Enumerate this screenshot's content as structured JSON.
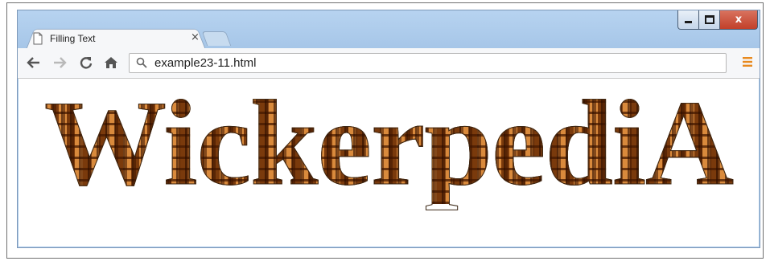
{
  "browser": {
    "tab_title": "Filling Text",
    "tab_close_glyph": "×",
    "close_glyph": "x",
    "url": "example23-11.html"
  },
  "page": {
    "text": "WickerpediA"
  },
  "icons": {
    "back": "back-arrow-icon",
    "forward": "forward-arrow-icon",
    "reload": "reload-icon",
    "home": "home-icon",
    "search": "search-icon",
    "menu": "hamburger-menu-icon",
    "document": "document-icon"
  },
  "colors": {
    "frame": "#a9c9ea",
    "close_button": "#c84a36",
    "menu_accent": "#e8891e",
    "wicker_fill": "#a85618"
  }
}
